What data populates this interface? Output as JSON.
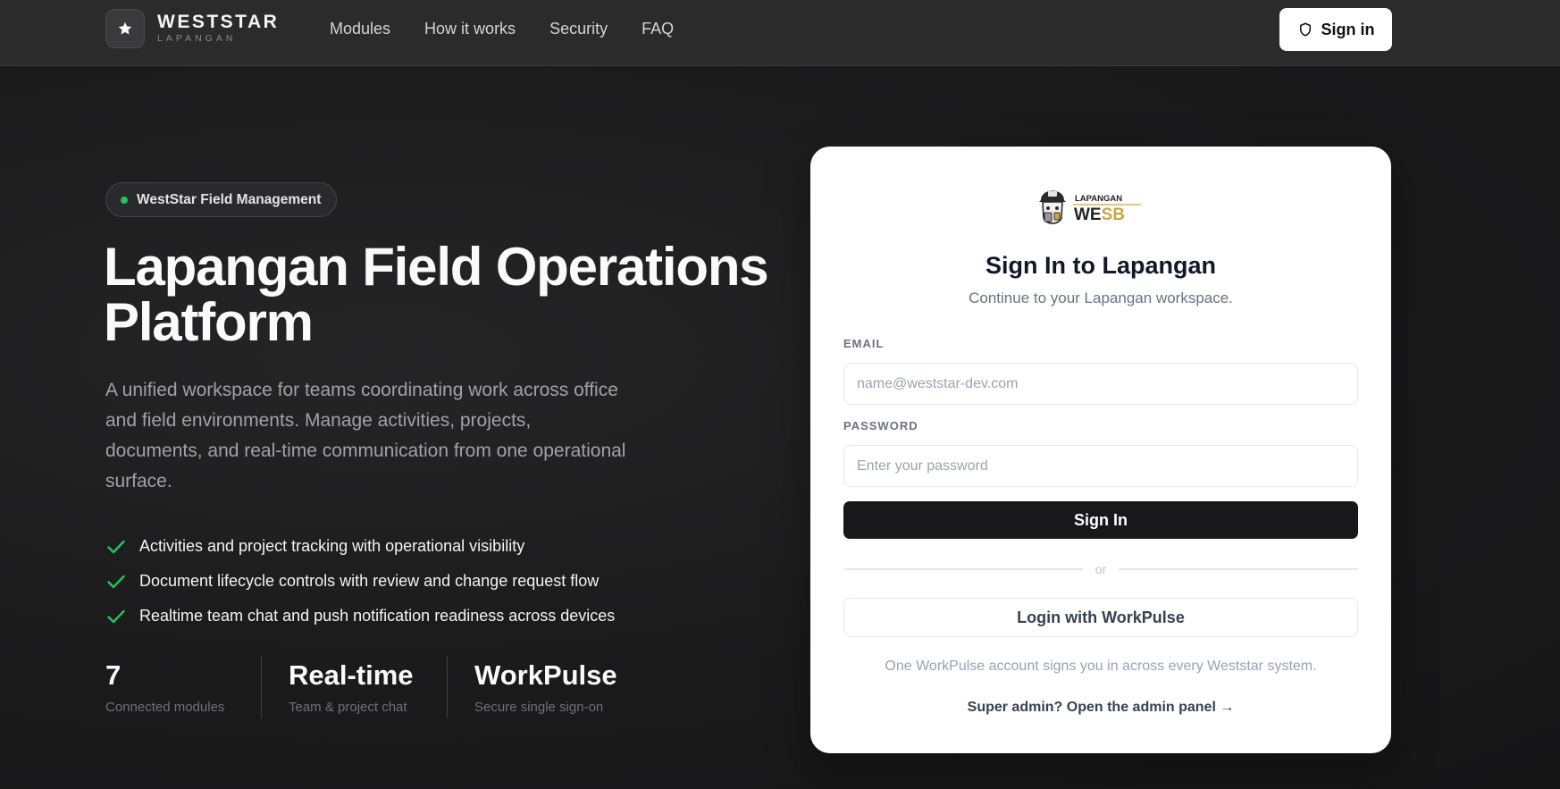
{
  "nav": {
    "brand_name": "WESTSTAR",
    "brand_sub": "LAPANGAN",
    "links": [
      "Modules",
      "How it works",
      "Security",
      "FAQ"
    ],
    "signin_label": "Sign in"
  },
  "hero": {
    "badge": "WestStar Field Management",
    "title": "Lapangan Field Operations Platform",
    "description": "A unified workspace for teams coordinating work across office and field environments. Manage activities, projects, documents, and real-time communication from one operational surface.",
    "features": [
      "Activities and project tracking with operational visibility",
      "Document lifecycle controls with review and change request flow",
      "Realtime team chat and push notification readiness across devices"
    ],
    "stats": [
      {
        "value": "7",
        "label": "Connected modules"
      },
      {
        "value": "Real-time",
        "label": "Team & project chat"
      },
      {
        "value": "WorkPulse",
        "label": "Secure single sign-on"
      }
    ]
  },
  "login": {
    "logo_small": "LAPANGAN",
    "logo_big": "WESB",
    "title": "Sign In to Lapangan",
    "subtitle": "Continue to your Lapangan workspace.",
    "email_label": "EMAIL",
    "email_placeholder": "name@weststar-dev.com",
    "password_label": "PASSWORD",
    "password_placeholder": "Enter your password",
    "submit_label": "Sign In",
    "divider": "or",
    "sso_label": "Login with WorkPulse",
    "note": "One WorkPulse account signs you in across every Weststar system.",
    "admin_link": "Super admin? Open the admin panel →"
  },
  "colors": {
    "accent_green": "#22c55e",
    "primary_button": "#18181b",
    "logo_gold": "#c9a54a"
  },
  "icons": [
    "star-icon",
    "shield-icon",
    "check-icon",
    "mascot-icon"
  ]
}
